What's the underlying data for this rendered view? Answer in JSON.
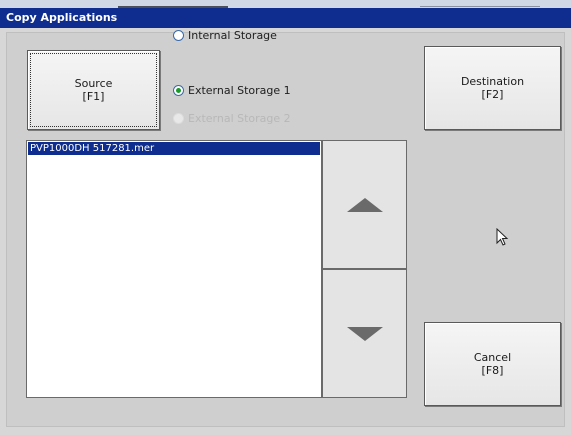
{
  "window": {
    "title": "Copy Applications"
  },
  "source_button": {
    "label": "Source",
    "key": "[F1]"
  },
  "destination_button": {
    "label": "Destination",
    "key": "[F2]"
  },
  "cancel_button": {
    "label": "Cancel",
    "key": "[F8]"
  },
  "storage_options": [
    {
      "label": "Internal Storage",
      "selected": false,
      "enabled": true
    },
    {
      "label": "External Storage 1",
      "selected": true,
      "enabled": true
    },
    {
      "label": "External Storage 2",
      "selected": false,
      "enabled": false
    }
  ],
  "file_list": {
    "items": [
      "PVP1000DH 517281.mer"
    ],
    "selected_index": 0
  },
  "icons": {
    "scroll_up": "triangle-up-icon",
    "scroll_down": "triangle-down-icon",
    "pointer": "mouse-pointer-icon"
  },
  "colors": {
    "title_bar": "#0e2d8f",
    "selection": "#0e2d8f",
    "radio_selected": "#1a9a2a"
  }
}
